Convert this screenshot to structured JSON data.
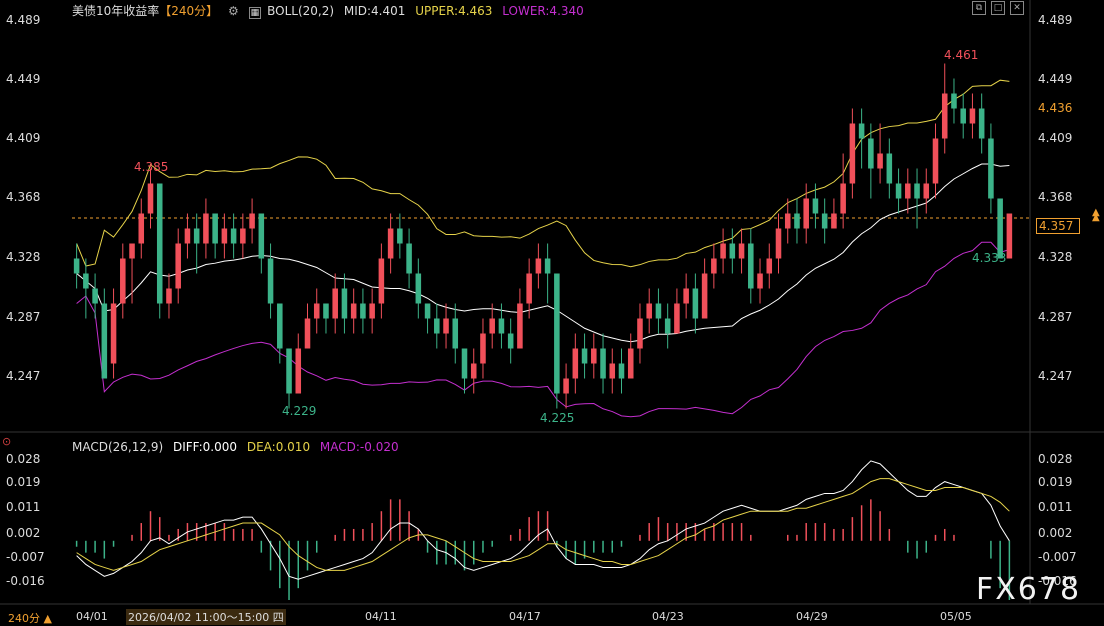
{
  "header": {
    "instrument": "美债10年收益率",
    "period_tag": "【240分】",
    "settings_icon": "gear-icon",
    "boll_label": "BOLL(20,2)",
    "mid": "MID:4.401",
    "upper": "UPPER:4.463",
    "lower": "LOWER:4.340"
  },
  "window_controls": [
    "restore-icon",
    "maximize-icon",
    "close-icon"
  ],
  "main_y_labels": [
    "4.489",
    "4.449",
    "4.409",
    "4.368",
    "4.328",
    "4.287",
    "4.247"
  ],
  "price_tags": {
    "high_marker": "4.436",
    "current": "4.357"
  },
  "annotations": {
    "a1": "4.385",
    "a2": "4.229",
    "a3": "4.225",
    "a4": "4.461",
    "a5": "4.333"
  },
  "macd_header": {
    "label": "MACD(26,12,9)",
    "diff": "DIFF:0.000",
    "dea": "DEA:0.010",
    "macd": "MACD:-0.020"
  },
  "macd_y_labels": [
    "0.028",
    "0.019",
    "0.011",
    "0.002",
    "-0.007",
    "-0.016"
  ],
  "macd_y_labels_right": [
    "0.028",
    "0.019",
    "0.011",
    "0.002",
    "-0.007",
    "-0.016"
  ],
  "x_labels": [
    "04/01",
    "04/11",
    "04/17",
    "04/23",
    "04/29",
    "05/05"
  ],
  "footer": {
    "period": "240分",
    "arrow": "▲",
    "tooltip": "2026/04/02 11:00～15:00 四"
  },
  "watermark": "FX678",
  "colors": {
    "up": "#f0505a",
    "down": "#3cb389",
    "mid": "#ffffff",
    "upper": "#e6d34a",
    "lower": "#c42fcf",
    "dea": "#e6d34a"
  },
  "chart_data": {
    "type": "candlestick",
    "ylim": [
      4.225,
      4.489
    ],
    "macd_ylim": [
      -0.02,
      0.03
    ],
    "candles": [
      [
        4.33,
        4.32,
        4.34,
        4.31
      ],
      [
        4.32,
        4.31,
        4.33,
        4.29
      ],
      [
        4.31,
        4.3,
        4.32,
        4.29
      ],
      [
        4.3,
        4.25,
        4.31,
        4.25
      ],
      [
        4.26,
        4.3,
        4.31,
        4.25
      ],
      [
        4.3,
        4.33,
        4.34,
        4.29
      ],
      [
        4.33,
        4.34,
        4.34,
        4.3
      ],
      [
        4.34,
        4.36,
        4.37,
        4.33
      ],
      [
        4.36,
        4.38,
        4.39,
        4.35
      ],
      [
        4.38,
        4.3,
        4.38,
        4.29
      ],
      [
        4.3,
        4.31,
        4.32,
        4.29
      ],
      [
        4.31,
        4.34,
        4.35,
        4.3
      ],
      [
        4.34,
        4.35,
        4.36,
        4.33
      ],
      [
        4.35,
        4.34,
        4.36,
        4.32
      ],
      [
        4.34,
        4.36,
        4.37,
        4.33
      ],
      [
        4.36,
        4.34,
        4.36,
        4.33
      ],
      [
        4.34,
        4.35,
        4.36,
        4.33
      ],
      [
        4.35,
        4.34,
        4.36,
        4.33
      ],
      [
        4.34,
        4.35,
        4.36,
        4.33
      ],
      [
        4.35,
        4.36,
        4.37,
        4.34
      ],
      [
        4.36,
        4.33,
        4.36,
        4.32
      ],
      [
        4.33,
        4.3,
        4.34,
        4.29
      ],
      [
        4.3,
        4.27,
        4.3,
        4.26
      ],
      [
        4.27,
        4.24,
        4.27,
        4.23
      ],
      [
        4.24,
        4.27,
        4.28,
        4.24
      ],
      [
        4.27,
        4.29,
        4.3,
        4.27
      ],
      [
        4.29,
        4.3,
        4.31,
        4.28
      ],
      [
        4.3,
        4.29,
        4.3,
        4.28
      ],
      [
        4.29,
        4.31,
        4.32,
        4.28
      ],
      [
        4.31,
        4.29,
        4.32,
        4.28
      ],
      [
        4.29,
        4.3,
        4.31,
        4.28
      ],
      [
        4.3,
        4.29,
        4.31,
        4.28
      ],
      [
        4.29,
        4.3,
        4.31,
        4.28
      ],
      [
        4.3,
        4.33,
        4.34,
        4.29
      ],
      [
        4.33,
        4.35,
        4.36,
        4.32
      ],
      [
        4.35,
        4.34,
        4.36,
        4.33
      ],
      [
        4.34,
        4.32,
        4.35,
        4.31
      ],
      [
        4.32,
        4.3,
        4.33,
        4.29
      ],
      [
        4.3,
        4.29,
        4.3,
        4.28
      ],
      [
        4.29,
        4.28,
        4.3,
        4.27
      ],
      [
        4.28,
        4.29,
        4.3,
        4.27
      ],
      [
        4.29,
        4.27,
        4.3,
        4.26
      ],
      [
        4.27,
        4.25,
        4.27,
        4.24
      ],
      [
        4.25,
        4.26,
        4.27,
        4.24
      ],
      [
        4.26,
        4.28,
        4.29,
        4.25
      ],
      [
        4.28,
        4.29,
        4.3,
        4.27
      ],
      [
        4.29,
        4.28,
        4.3,
        4.27
      ],
      [
        4.28,
        4.27,
        4.29,
        4.26
      ],
      [
        4.27,
        4.3,
        4.31,
        4.27
      ],
      [
        4.3,
        4.32,
        4.33,
        4.29
      ],
      [
        4.32,
        4.33,
        4.34,
        4.31
      ],
      [
        4.33,
        4.32,
        4.34,
        4.3
      ],
      [
        4.32,
        4.24,
        4.32,
        4.23
      ],
      [
        4.24,
        4.25,
        4.26,
        4.23
      ],
      [
        4.25,
        4.27,
        4.28,
        4.24
      ],
      [
        4.27,
        4.26,
        4.28,
        4.25
      ],
      [
        4.26,
        4.27,
        4.28,
        4.25
      ],
      [
        4.27,
        4.25,
        4.28,
        4.24
      ],
      [
        4.25,
        4.26,
        4.27,
        4.24
      ],
      [
        4.26,
        4.25,
        4.27,
        4.24
      ],
      [
        4.25,
        4.27,
        4.28,
        4.25
      ],
      [
        4.27,
        4.29,
        4.3,
        4.26
      ],
      [
        4.29,
        4.3,
        4.31,
        4.28
      ],
      [
        4.3,
        4.29,
        4.31,
        4.28
      ],
      [
        4.29,
        4.28,
        4.3,
        4.27
      ],
      [
        4.28,
        4.3,
        4.31,
        4.28
      ],
      [
        4.3,
        4.31,
        4.32,
        4.29
      ],
      [
        4.31,
        4.29,
        4.32,
        4.28
      ],
      [
        4.29,
        4.32,
        4.33,
        4.29
      ],
      [
        4.32,
        4.33,
        4.34,
        4.31
      ],
      [
        4.33,
        4.34,
        4.35,
        4.32
      ],
      [
        4.34,
        4.33,
        4.35,
        4.32
      ],
      [
        4.33,
        4.34,
        4.35,
        4.32
      ],
      [
        4.34,
        4.31,
        4.35,
        4.3
      ],
      [
        4.31,
        4.32,
        4.33,
        4.3
      ],
      [
        4.32,
        4.33,
        4.34,
        4.31
      ],
      [
        4.33,
        4.35,
        4.36,
        4.32
      ],
      [
        4.35,
        4.36,
        4.37,
        4.34
      ],
      [
        4.36,
        4.35,
        4.37,
        4.34
      ],
      [
        4.35,
        4.37,
        4.38,
        4.34
      ],
      [
        4.37,
        4.36,
        4.38,
        4.35
      ],
      [
        4.36,
        4.35,
        4.37,
        4.34
      ],
      [
        4.35,
        4.36,
        4.37,
        4.35
      ],
      [
        4.36,
        4.38,
        4.4,
        4.35
      ],
      [
        4.38,
        4.42,
        4.43,
        4.37
      ],
      [
        4.42,
        4.41,
        4.43,
        4.39
      ],
      [
        4.41,
        4.39,
        4.42,
        4.37
      ],
      [
        4.39,
        4.4,
        4.42,
        4.38
      ],
      [
        4.4,
        4.38,
        4.41,
        4.37
      ],
      [
        4.38,
        4.37,
        4.39,
        4.36
      ],
      [
        4.37,
        4.38,
        4.39,
        4.36
      ],
      [
        4.38,
        4.37,
        4.39,
        4.35
      ],
      [
        4.37,
        4.38,
        4.39,
        4.36
      ],
      [
        4.38,
        4.41,
        4.42,
        4.37
      ],
      [
        4.41,
        4.44,
        4.46,
        4.4
      ],
      [
        4.44,
        4.43,
        4.45,
        4.42
      ],
      [
        4.43,
        4.42,
        4.44,
        4.41
      ],
      [
        4.42,
        4.43,
        4.44,
        4.41
      ],
      [
        4.43,
        4.41,
        4.44,
        4.4
      ],
      [
        4.41,
        4.37,
        4.42,
        4.36
      ],
      [
        4.37,
        4.33,
        4.37,
        4.33
      ],
      [
        4.33,
        4.36,
        4.36,
        4.33
      ]
    ],
    "macd": {
      "diff": [
        -0.005,
        -0.008,
        -0.01,
        -0.012,
        -0.011,
        -0.009,
        -0.007,
        -0.004,
        0.0,
        0.001,
        -0.001,
        0.001,
        0.003,
        0.004,
        0.005,
        0.006,
        0.007,
        0.007,
        0.008,
        0.008,
        0.004,
        -0.001,
        -0.006,
        -0.012,
        -0.013,
        -0.012,
        -0.011,
        -0.01,
        -0.009,
        -0.008,
        -0.007,
        -0.006,
        -0.004,
        0.0,
        0.004,
        0.006,
        0.006,
        0.004,
        0.0,
        -0.003,
        -0.004,
        -0.006,
        -0.009,
        -0.01,
        -0.009,
        -0.008,
        -0.007,
        -0.006,
        -0.004,
        -0.001,
        0.002,
        0.004,
        -0.002,
        -0.006,
        -0.008,
        -0.008,
        -0.008,
        -0.009,
        -0.009,
        -0.009,
        -0.008,
        -0.006,
        -0.003,
        -0.001,
        0.0,
        0.002,
        0.004,
        0.005,
        0.006,
        0.008,
        0.01,
        0.011,
        0.012,
        0.011,
        0.01,
        0.01,
        0.01,
        0.011,
        0.012,
        0.014,
        0.015,
        0.016,
        0.016,
        0.017,
        0.02,
        0.024,
        0.027,
        0.026,
        0.023,
        0.02,
        0.017,
        0.015,
        0.015,
        0.018,
        0.02,
        0.019,
        0.018,
        0.017,
        0.016,
        0.012,
        0.005,
        0.0
      ],
      "dea": [
        -0.004,
        -0.006,
        -0.008,
        -0.009,
        -0.01,
        -0.009,
        -0.008,
        -0.007,
        -0.005,
        -0.003,
        -0.002,
        -0.001,
        0.0,
        0.001,
        0.002,
        0.003,
        0.004,
        0.005,
        0.006,
        0.006,
        0.006,
        0.004,
        0.002,
        -0.002,
        -0.005,
        -0.007,
        -0.009,
        -0.01,
        -0.01,
        -0.01,
        -0.009,
        -0.008,
        -0.007,
        -0.005,
        -0.003,
        -0.001,
        0.001,
        0.002,
        0.002,
        0.001,
        0.0,
        -0.002,
        -0.004,
        -0.006,
        -0.007,
        -0.007,
        -0.007,
        -0.007,
        -0.006,
        -0.005,
        -0.003,
        -0.001,
        -0.001,
        -0.003,
        -0.004,
        -0.005,
        -0.006,
        -0.007,
        -0.007,
        -0.008,
        -0.008,
        -0.007,
        -0.006,
        -0.005,
        -0.003,
        -0.001,
        0.001,
        0.002,
        0.004,
        0.005,
        0.007,
        0.008,
        0.009,
        0.01,
        0.01,
        0.01,
        0.01,
        0.01,
        0.011,
        0.011,
        0.012,
        0.013,
        0.014,
        0.015,
        0.016,
        0.018,
        0.02,
        0.021,
        0.021,
        0.02,
        0.019,
        0.018,
        0.017,
        0.017,
        0.018,
        0.018,
        0.018,
        0.017,
        0.016,
        0.015,
        0.013,
        0.01
      ]
    }
  }
}
